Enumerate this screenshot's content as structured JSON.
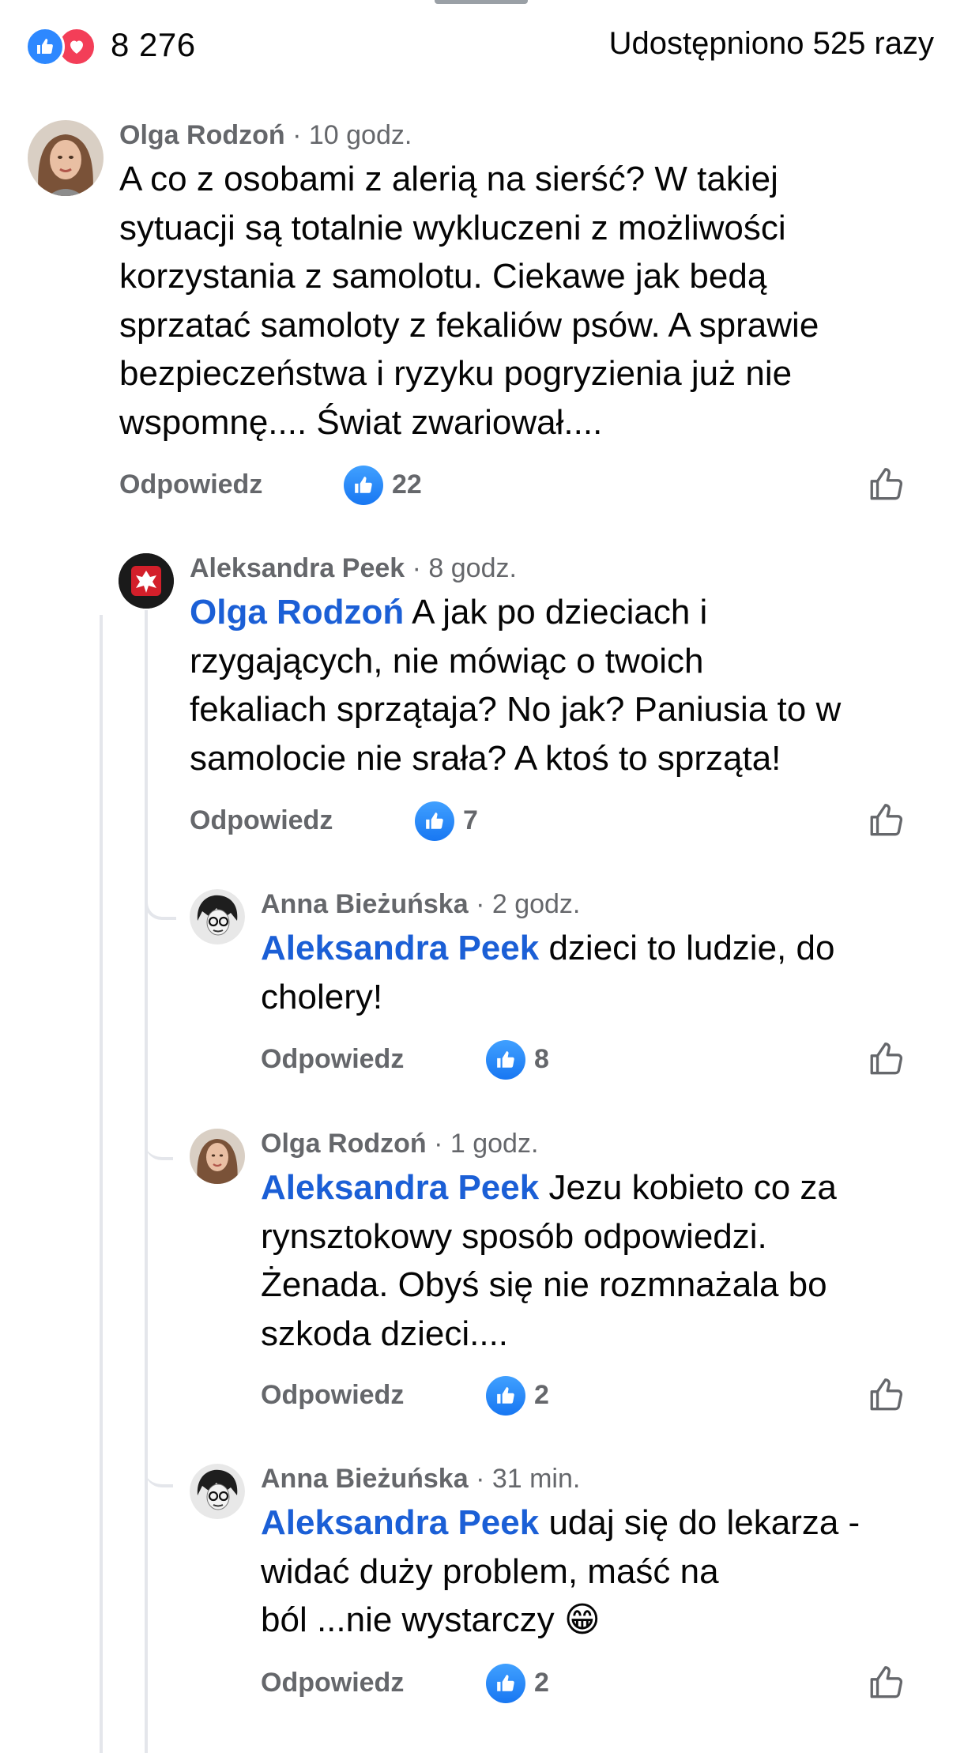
{
  "summary": {
    "reaction_icons": [
      "like-icon",
      "love-icon"
    ],
    "reaction_count": "8 276",
    "share_text": "Udostępniono 525 razy"
  },
  "colors": {
    "accent": "#1b5fd6",
    "like_blue": "#1877f2",
    "love_red": "#f33e58",
    "muted": "#65676b",
    "thread_line": "#e4e6eb"
  },
  "reply_label": "Odpowiedz",
  "comments": [
    {
      "author": "Olga Rodzoń",
      "time": "· 10 godz.",
      "mention": "",
      "lines": [
        "A co z osobami z alerią na sierść? W takiej",
        "sytuacji są totalnie wykluczeni z możliwości",
        "korzystania z samolotu. Ciekawe jak bedą",
        "sprzatać samoloty z fekaliów psów. A sprawie",
        "bezpieczeństwa i ryzyku pogryzienia już nie",
        "wspomnę.... Świat zwariował...."
      ],
      "likes": "22"
    },
    {
      "author": "Aleksandra Peek",
      "time": "· 8 godz.",
      "mention": "Olga Rodzoń",
      "lines": [
        " A jak po dzieciach i",
        "rzygających, nie mówiąc o twoich",
        "fekaliach sprzątaja? No jak? Paniusia to w",
        "samolocie nie srała? A ktoś to sprząta!"
      ],
      "likes": "7"
    },
    {
      "author": "Anna Bieżuńska",
      "time": "· 2 godz.",
      "mention": "Aleksandra Peek",
      "lines": [
        " dzieci to ludzie, do",
        "cholery!"
      ],
      "likes": "8"
    },
    {
      "author": "Olga Rodzoń",
      "time": "· 1 godz.",
      "mention": "Aleksandra Peek",
      "lines": [
        " Jezu kobieto co za",
        "rynsztokowy sposób odpowiedzi.",
        "Żenada. Obyś się nie rozmnażala bo",
        "szkoda dzieci...."
      ],
      "likes": "2"
    },
    {
      "author": "Anna Bieżuńska",
      "time": "· 31 min.",
      "mention": "Aleksandra Peek",
      "lines": [
        " udaj się do lekarza -",
        "widać duży problem, maść na",
        "ból ...nie wystarczy 😁"
      ],
      "likes": "2"
    }
  ]
}
